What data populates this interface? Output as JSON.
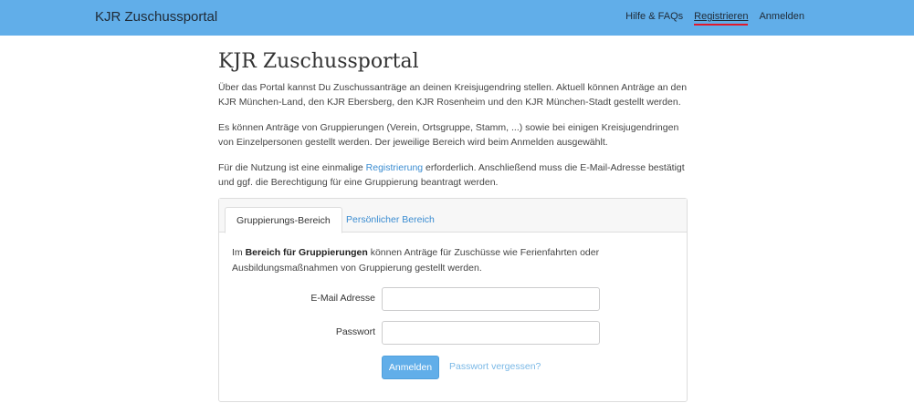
{
  "navbar": {
    "brand": "KJR Zuschussportal",
    "links": [
      {
        "label": "Hilfe & FAQs"
      },
      {
        "label": "Registrieren"
      },
      {
        "label": "Anmelden"
      }
    ]
  },
  "main": {
    "title": "KJR Zuschussportal",
    "para1": "Über das Portal kannst Du Zuschussanträge an deinen Kreisjugendring stellen. Aktuell können Anträge an den KJR München-Land, den KJR Ebersberg, den KJR Rosenheim und den KJR München-Stadt gestellt werden.",
    "para2": "Es können Anträge von Gruppierungen (Verein, Ortsgruppe, Stamm, ...) sowie bei einigen Kreisjugendringen von Einzelpersonen gestellt werden. Der jeweilige Bereich wird beim Anmelden ausgewählt.",
    "para3_before": "Für die Nutzung ist eine einmalige ",
    "para3_link": "Registrierung",
    "para3_after": " erforderlich. Anschließend muss die E-Mail-Adresse bestätigt und ggf. die Berechtigung für eine Gruppierung beantragt werden."
  },
  "card": {
    "tabs": [
      {
        "label": "Gruppierungs-Bereich"
      },
      {
        "label": "Persönlicher Bereich"
      }
    ],
    "text_before": "Im ",
    "text_bold": "Bereich für Gruppierungen",
    "text_after": " können Anträge für Zuschüsse wie Ferienfahrten oder Ausbildungsmaßnahmen von Gruppierung gestellt werden.",
    "email_label": "E-Mail Adresse",
    "email_value": "",
    "password_label": "Passwort",
    "password_value": "",
    "submit_label": "Anmelden",
    "forgot_label": "Passwort vergessen?"
  }
}
